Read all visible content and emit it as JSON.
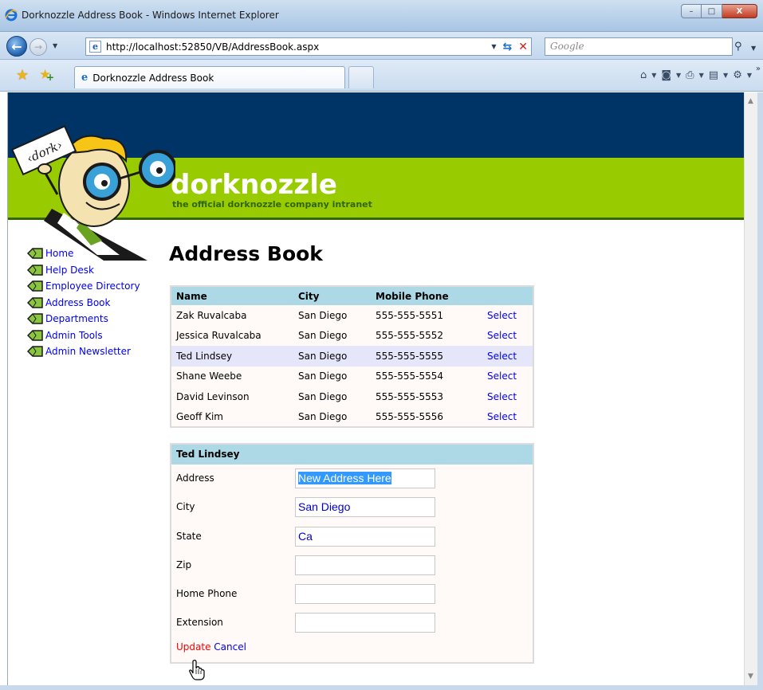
{
  "window": {
    "title": "Dorknozzle Address Book - Windows Internet Explorer",
    "controls": {
      "minimize": "–",
      "maximize": "□",
      "close": "X"
    }
  },
  "navbar": {
    "url": "http://localhost:52850/VB/AddressBook.aspx",
    "search_placeholder": "Google"
  },
  "tabs": [
    {
      "label": "Dorknozzle Address Book",
      "active": true
    }
  ],
  "site": {
    "brand": "dorknozzle",
    "tagline": "the official dorknozzle company intranet",
    "mascot_sign": "‹dork›",
    "colors": {
      "header_navy": "#003366",
      "header_green": "#99cc00",
      "grid_header": "#add8e6",
      "selected_row": "#e6e6fa"
    }
  },
  "sidebar": {
    "items": [
      {
        "label": "Home"
      },
      {
        "label": "Help Desk"
      },
      {
        "label": "Employee Directory"
      },
      {
        "label": "Address Book"
      },
      {
        "label": "Departments"
      },
      {
        "label": "Admin Tools"
      },
      {
        "label": "Admin Newsletter"
      }
    ]
  },
  "main": {
    "title": "Address Book",
    "grid": {
      "columns": [
        "Name",
        "City",
        "Mobile Phone"
      ],
      "select_label": "Select",
      "rows": [
        {
          "name": "Zak Ruvalcaba",
          "city": "San Diego",
          "phone": "555-555-5551",
          "selected": false
        },
        {
          "name": "Jessica Ruvalcaba",
          "city": "San Diego",
          "phone": "555-555-5552",
          "selected": false
        },
        {
          "name": "Ted Lindsey",
          "city": "San Diego",
          "phone": "555-555-5555",
          "selected": true
        },
        {
          "name": "Shane Weebe",
          "city": "San Diego",
          "phone": "555-555-5554",
          "selected": false
        },
        {
          "name": "David Levinson",
          "city": "San Diego",
          "phone": "555-555-5553",
          "selected": false
        },
        {
          "name": "Geoff Kim",
          "city": "San Diego",
          "phone": "555-555-5556",
          "selected": false
        }
      ]
    },
    "details": {
      "header": "Ted Lindsey",
      "fields": [
        {
          "label": "Address",
          "value": "New Address Here"
        },
        {
          "label": "City",
          "value": "San Diego"
        },
        {
          "label": "State",
          "value": "Ca"
        },
        {
          "label": "Zip",
          "value": ""
        },
        {
          "label": "Home Phone",
          "value": ""
        },
        {
          "label": "Extension",
          "value": ""
        }
      ],
      "update_label": "Update",
      "cancel_label": "Cancel"
    }
  }
}
